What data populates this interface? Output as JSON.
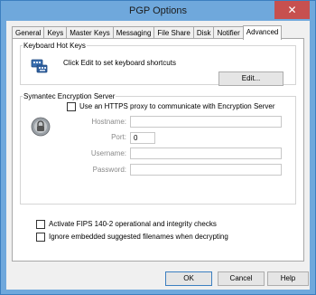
{
  "window": {
    "title": "PGP Options",
    "close_glyph": "✕"
  },
  "tabs": [
    {
      "label": "General"
    },
    {
      "label": "Keys"
    },
    {
      "label": "Master Keys"
    },
    {
      "label": "Messaging"
    },
    {
      "label": "File Share"
    },
    {
      "label": "Disk"
    },
    {
      "label": "Notifier"
    },
    {
      "label": "Advanced",
      "active": true
    }
  ],
  "hotkeys": {
    "title": "Keyboard Hot Keys",
    "description": "Click Edit to set keyboard shortcuts",
    "edit_label": "Edit...",
    "icon": "keyboard-icon"
  },
  "server": {
    "title": "Symantec Encryption Server",
    "proxy_label": "Use an HTTPS proxy to communicate with Encryption Server",
    "proxy_checked": false,
    "hostname_label": "Hostname:",
    "hostname_value": "",
    "port_label": "Port:",
    "port_value": "0",
    "username_label": "Username:",
    "username_value": "",
    "password_label": "Password:",
    "password_value": "",
    "icon": "lock-icon"
  },
  "options": {
    "fips_label": "Activate FIPS 140-2 operational and integrity checks",
    "fips_checked": false,
    "ignore_label": "Ignore embedded suggested filenames when decrypting",
    "ignore_checked": false
  },
  "buttons": {
    "ok": "OK",
    "cancel": "Cancel",
    "help": "Help"
  }
}
